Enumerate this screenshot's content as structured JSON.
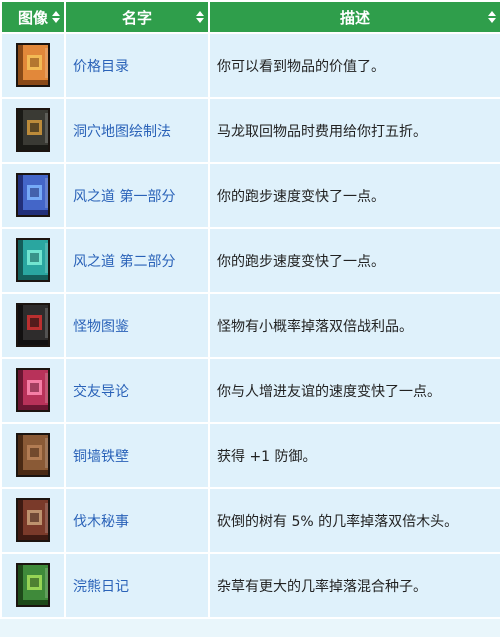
{
  "columns": [
    {
      "label": "图像"
    },
    {
      "label": "名字"
    },
    {
      "label": "描述"
    }
  ],
  "rows": [
    {
      "name": "价格目录",
      "desc": "你可以看到物品的价值了。",
      "icon": "orange-catalog-book-icon",
      "color": "#e2883a",
      "dark": "#8a4a18",
      "accent": "#f6c35a"
    },
    {
      "name": "洞穴地图绘制法",
      "desc": "马龙取回物品时费用给你打五折。",
      "icon": "cave-map-book-icon",
      "color": "#3a3a34",
      "dark": "#1a1a16",
      "accent": "#d49a3c"
    },
    {
      "name": "风之道 第一部分",
      "desc": "你的跑步速度变快了一点。",
      "icon": "blue-wind-book-icon",
      "color": "#4466c8",
      "dark": "#22307a",
      "accent": "#7fb6ff"
    },
    {
      "name": "风之道 第二部分",
      "desc": "你的跑步速度变快了一点。",
      "icon": "teal-wind-book-icon",
      "color": "#2aa6a0",
      "dark": "#145e5a",
      "accent": "#7ff0d8"
    },
    {
      "name": "怪物图鉴",
      "desc": "怪物有小概率掉落双倍战利品。",
      "icon": "monster-compendium-book-icon",
      "color": "#2e2c2c",
      "dark": "#121010",
      "accent": "#d23030"
    },
    {
      "name": "交友导论",
      "desc": "你与人增进友谊的速度变快了一点。",
      "icon": "friendship-heart-book-icon",
      "color": "#b8325a",
      "dark": "#6a1632",
      "accent": "#ff8cb4"
    },
    {
      "name": "铜墙铁壁",
      "desc": "获得 +1 防御。",
      "icon": "brown-defense-book-icon",
      "color": "#8a5a36",
      "dark": "#4a2a14",
      "accent": "#b88258"
    },
    {
      "name": "伐木秘事",
      "desc": "砍倒的树有 5% 的几率掉落双倍木头。",
      "icon": "woodcutting-axe-book-icon",
      "color": "#7a3a2a",
      "dark": "#3e1a12",
      "accent": "#c9a27a"
    },
    {
      "name": "浣熊日记",
      "desc": "杂草有更大的几率掉落混合种子。",
      "icon": "green-raccoon-journal-icon",
      "color": "#3f8a3a",
      "dark": "#1e4a1a",
      "accent": "#a6e05a"
    }
  ]
}
